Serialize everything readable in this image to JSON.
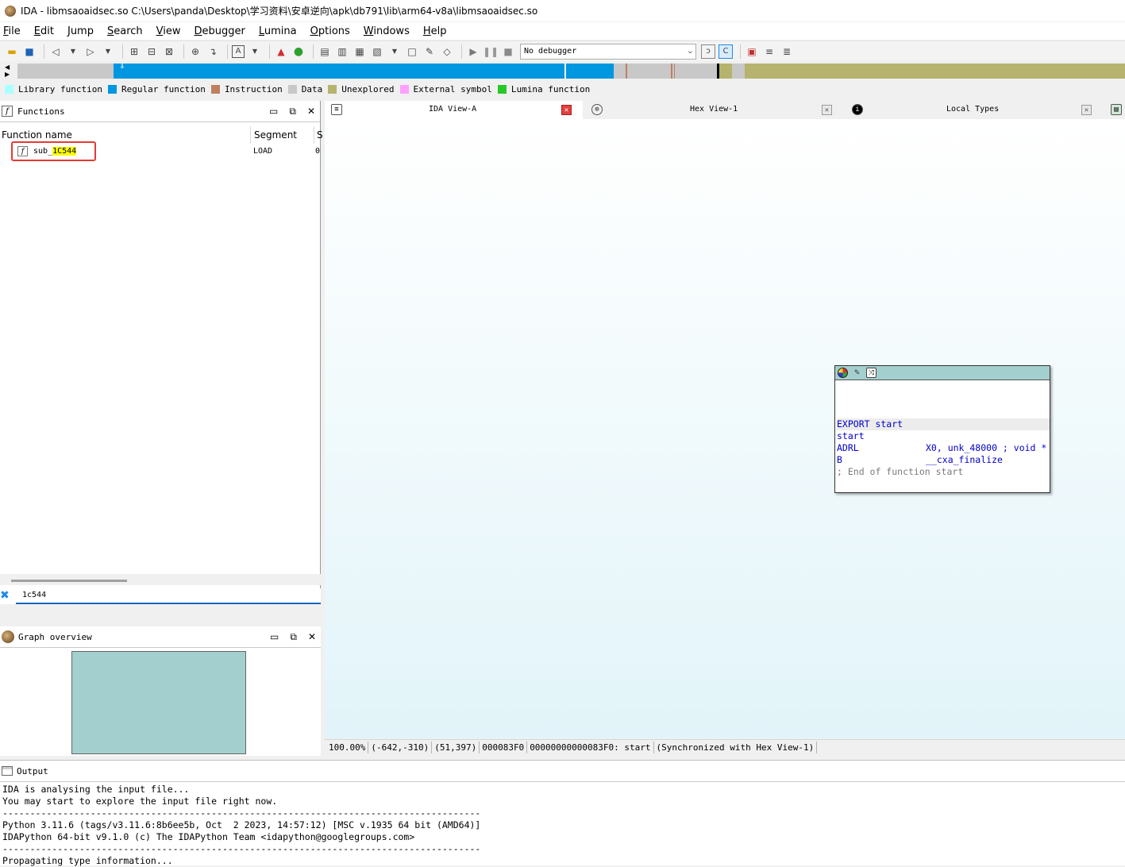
{
  "window": {
    "title": "IDA - libmsaoaidsec.so C:\\Users\\panda\\Desktop\\学习资料\\安卓逆向\\apk\\db791\\lib\\arm64-v8a\\libmsaoaidsec.so"
  },
  "menu": [
    {
      "label": "File",
      "ul": "F",
      "rest": "ile"
    },
    {
      "label": "Edit",
      "ul": "E",
      "rest": "dit"
    },
    {
      "label": "Jump",
      "ul": "J",
      "rest": "ump"
    },
    {
      "label": "Search",
      "ul": "S",
      "rest": "earch"
    },
    {
      "label": "View",
      "ul": "V",
      "rest": "iew"
    },
    {
      "label": "Debugger",
      "ul": "D",
      "rest": "ebugger"
    },
    {
      "label": "Lumina",
      "ul": "L",
      "rest": "umina"
    },
    {
      "label": "Options",
      "ul": "O",
      "rest": "ptions"
    },
    {
      "label": "Windows",
      "ul": "W",
      "rest": "indows"
    },
    {
      "label": "Help",
      "ul": "H",
      "rest": "elp"
    }
  ],
  "toolbar": {
    "debugger_select": "No debugger"
  },
  "legend": [
    {
      "label": "Library function",
      "color": "#aaffff"
    },
    {
      "label": "Regular function",
      "color": "#0096e0"
    },
    {
      "label": "Instruction",
      "color": "#c08060"
    },
    {
      "label": "Data",
      "color": "#c8c8c8"
    },
    {
      "label": "Unexplored",
      "color": "#b5b36e"
    },
    {
      "label": "External symbol",
      "color": "#ffa0ff"
    },
    {
      "label": "Lumina function",
      "color": "#28c828"
    }
  ],
  "functions": {
    "title": "Functions",
    "col_name": "Function name",
    "col_segment": "Segment",
    "col_start": "S",
    "rows": [
      {
        "name_prefix": "sub_",
        "name_highlight": "1C544",
        "segment": "LOAD",
        "start": "0"
      }
    ],
    "filter_value": "1c544"
  },
  "graph_overview": {
    "title": "Graph overview"
  },
  "tabs": [
    {
      "label": "IDA View-A",
      "icon": "IDA"
    },
    {
      "label": "Hex View-1",
      "icon": "hex"
    },
    {
      "label": "Local Types",
      "icon": "types"
    }
  ],
  "graph_node": {
    "lines": [
      {
        "a": "EXPORT start",
        "b": "",
        "type": "kw"
      },
      {
        "a": "start",
        "b": "",
        "type": "kw"
      },
      {
        "a": "ADRL",
        "b": "X0, unk_48000 ; void *",
        "type": "kw"
      },
      {
        "a": "B",
        "b": "__cxa_finalize",
        "type": "kw"
      },
      {
        "a": "; End of function start",
        "b": "",
        "type": "cmt"
      }
    ]
  },
  "statusbar": {
    "zoom": "100.00%",
    "coords1": "(-642,-310)",
    "coords2": "(51,397)",
    "offset": "000083F0",
    "address": "00000000000083F0: start",
    "sync": "(Synchronized with Hex View-1)"
  },
  "output": {
    "title": "Output",
    "lines": [
      "IDA is analysing the input file...",
      "You may start to explore the input file right now.",
      "---------------------------------------------------------------------------------------",
      "Python 3.11.6 (tags/v3.11.6:8b6ee5b, Oct  2 2023, 14:57:12) [MSC v.1935 64 bit (AMD64)]",
      "IDAPython 64-bit v9.1.0 (c) The IDAPython Team <idapython@googlegroups.com>",
      "---------------------------------------------------------------------------------------",
      "Propagating type information..."
    ]
  }
}
